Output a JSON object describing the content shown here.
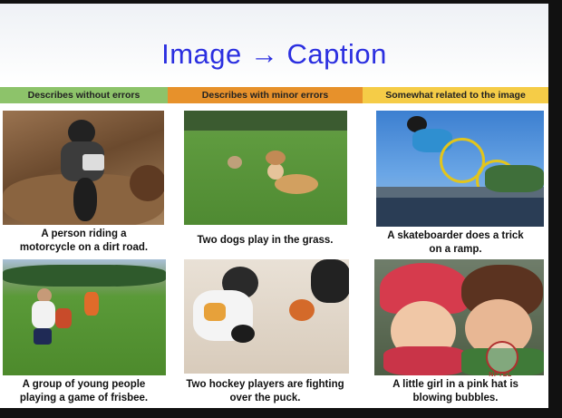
{
  "slide": {
    "title": "Image → Caption",
    "categories": [
      {
        "label": "Describes without errors",
        "color": "#8dc36a"
      },
      {
        "label": "Describes with minor errors",
        "color": "#e7912b"
      },
      {
        "label": "Somewhat related to the image",
        "color": "#f5cc47"
      }
    ],
    "examples": [
      {
        "caption_line1": "A person riding a",
        "caption_line2": "motorcycle on a dirt road.",
        "image": "motocross-rider-photo"
      },
      {
        "caption_line1": "Two dogs play in the grass.",
        "caption_line2": "",
        "image": "dogs-on-grass-photo"
      },
      {
        "caption_line1": "A skateboarder does a trick",
        "caption_line2": "on a ramp.",
        "image": "bmx-rider-photo"
      },
      {
        "caption_line1": "A group of young people",
        "caption_line2": "playing a game of frisbee.",
        "image": "frisbee-players-photo"
      },
      {
        "caption_line1": "Two hockey players are fighting",
        "caption_line2": "over the puck.",
        "image": "hockey-players-photo"
      },
      {
        "caption_line1": "A little girl in a pink hat is",
        "caption_line2": "blowing bubbles.",
        "image": "children-in-hats-photo"
      }
    ],
    "watermark": "NPTEL"
  }
}
